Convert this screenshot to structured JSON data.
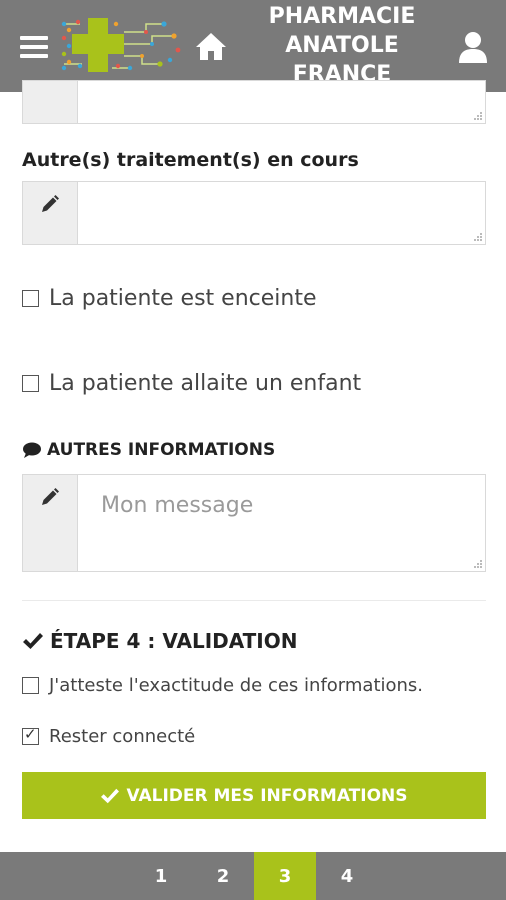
{
  "header": {
    "title_lines": [
      "PHARMACIE",
      "ANATOLE",
      "FRANCE"
    ],
    "icons": {
      "menu": "menu-icon",
      "home": "home-icon",
      "user": "user-icon",
      "logo": "pharmacy-cross-logo"
    },
    "colors": {
      "bar": "#7a7a7a",
      "accent": "#a9c21b"
    }
  },
  "form": {
    "other_treatments_label": "Autre(s) traitement(s) en cours",
    "other_treatments_value": "",
    "pregnant_label": "La patiente est enceinte",
    "pregnant_checked": false,
    "breastfeeding_label": "La patiente allaite un enfant",
    "breastfeeding_checked": false,
    "other_info_title": "AUTRES INFORMATIONS",
    "message_placeholder": "Mon message",
    "message_value": ""
  },
  "validation": {
    "title": "ÉTAPE 4 : VALIDATION",
    "attest_label": "J'atteste l'exactitude de ces informations.",
    "attest_checked": false,
    "stay_connected_label": "Rester connecté",
    "stay_connected_checked": true,
    "submit_label": "VALIDER MES INFORMATIONS"
  },
  "pager": {
    "pages": [
      "1",
      "2",
      "3",
      "4"
    ],
    "active": "3"
  }
}
